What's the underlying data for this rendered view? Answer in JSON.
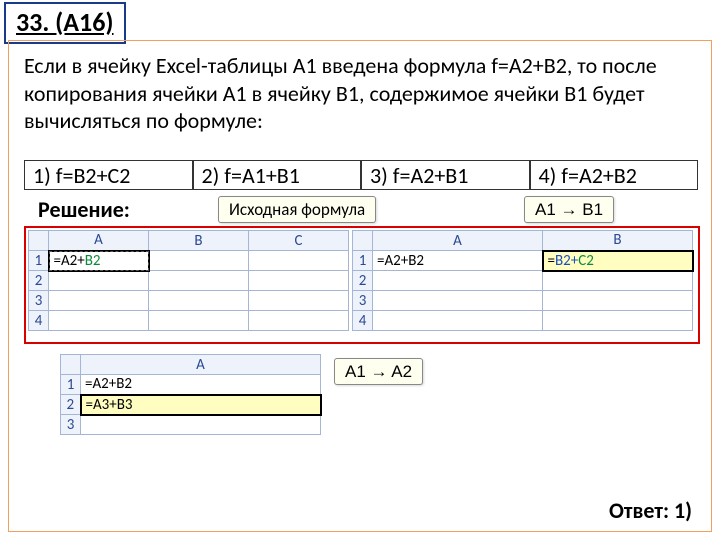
{
  "title": "33. (А16)",
  "problem": "Если в ячейку Excel-таблицы A1 введена формула f=A2+B2, то после копирования ячейки A1 в ячейку B1, содержимое ячейки B1 будет вычисляться по формуле:",
  "options": {
    "o1": "1) f=B2+C2",
    "o2": "2) f=A1+B1",
    "o3": "3) f=A2+B1",
    "o4": "4) f=A2+B2"
  },
  "labels": {
    "solve": "Решение:",
    "src": "Исходная формула",
    "a1b1": "A1 → B1",
    "a1a2": "A1 → A2",
    "answer": "Ответ: 1)"
  },
  "tbl1": {
    "headers": [
      "A",
      "B",
      "C"
    ],
    "rows": [
      "1",
      "2",
      "3",
      "4"
    ],
    "a1_prefix": "=A2+",
    "a1_b2": "B2"
  },
  "tbl2": {
    "headers": [
      "A",
      "B"
    ],
    "rows": [
      "1",
      "2",
      "3",
      "4"
    ],
    "a1": "=A2+B2",
    "b1_prefix": "=",
    "b1_b2": "B2+",
    "b1_c2": "C2"
  },
  "tbl3": {
    "headers": [
      "A"
    ],
    "rows": [
      "1",
      "2",
      "3"
    ],
    "a1": "=A2+B2",
    "a2": "=A3+B3"
  }
}
